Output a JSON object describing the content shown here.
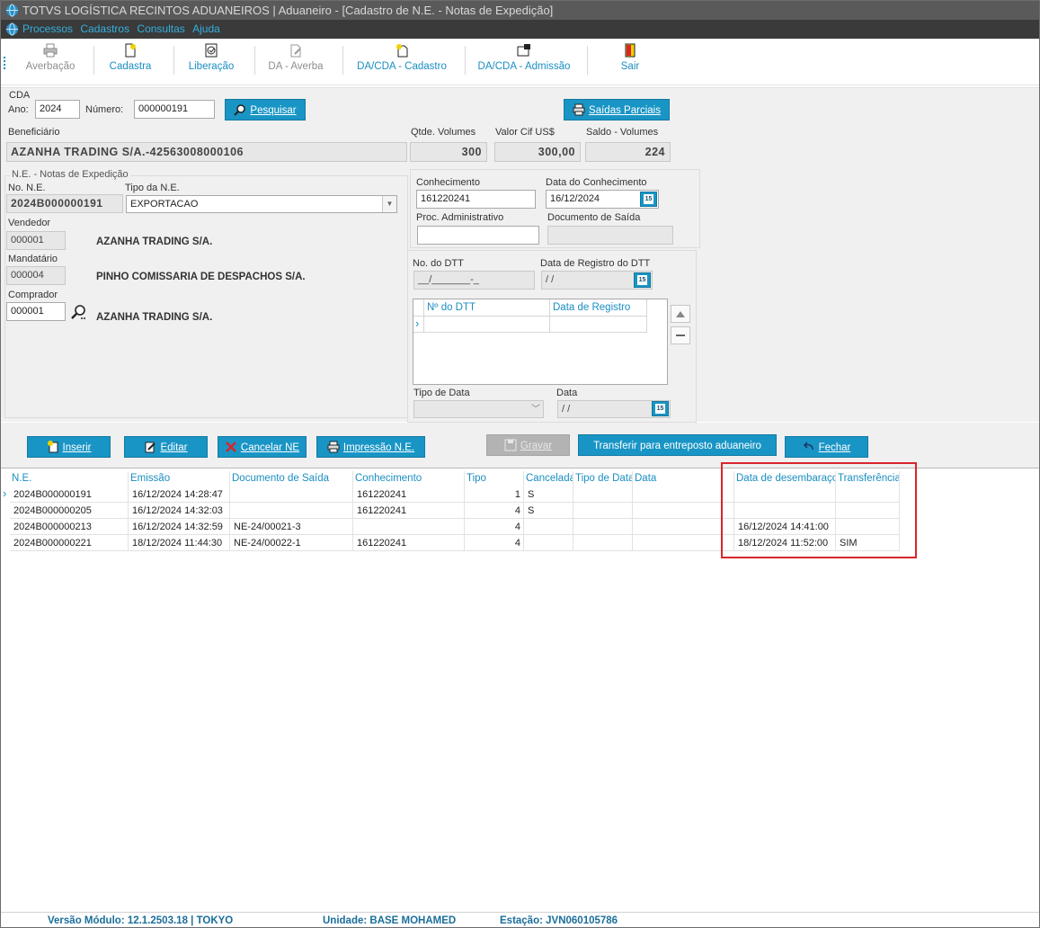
{
  "title": "TOTVS LOGÍSTICA RECINTOS ADUANEIROS | Aduaneiro - [Cadastro de N.E. - Notas de Expedição]",
  "menu": [
    "Processos",
    "Cadastros",
    "Consultas",
    "Ajuda"
  ],
  "toolbar": {
    "averbacao": "Averbação",
    "cadastra": "Cadastra",
    "liberacao": "Liberação",
    "da_averba": "DA - Averba",
    "dacda_cadastro": "DA/CDA - Cadastro",
    "dacda_admissao": "DA/CDA - Admissão",
    "sair": "Sair"
  },
  "cda": {
    "section": "CDA",
    "ano_label": "Ano:",
    "ano": "2024",
    "numero_label": "Número:",
    "numero": "000000191",
    "pesquisar": "Pesquisar",
    "saidas_parciais": "Saídas Parciais"
  },
  "beneficiario": {
    "label": "Beneficiário",
    "value": "AZANHA TRADING S/A.-42563008000106",
    "qtde_label": "Qtde. Volumes",
    "qtde": "300",
    "valor_label": "Valor Cif US$",
    "valor": "300,00",
    "saldo_label": "Saldo - Volumes",
    "saldo": "224"
  },
  "ne": {
    "group": "N.E. - Notas de Expedição",
    "no_label": "No. N.E.",
    "no": "2024B000000191",
    "tipo_label": "Tipo da N.E.",
    "tipo": "EXPORTACAO",
    "vendedor_label": "Vendedor",
    "vendedor_code": "000001",
    "vendedor_name": "AZANHA TRADING S/A.",
    "mandatario_label": "Mandatário",
    "mandatario_code": "000004",
    "mandatario_name": "PINHO COMISSARIA DE DESPACHOS S/A.",
    "comprador_label": "Comprador",
    "comprador_code": "000001",
    "comprador_name": "AZANHA TRADING S/A."
  },
  "conhecimento": {
    "label": "Conhecimento",
    "value": "161220241",
    "data_label": "Data do Conhecimento",
    "data": "16/12/2024",
    "proc_label": "Proc. Administrativo",
    "proc": "",
    "doc_label": "Documento de Saída",
    "doc": ""
  },
  "dtt": {
    "no_label": "No. do DTT",
    "no_mask": "__/_______-_",
    "data_reg_label": "Data de Registro do DTT",
    "data_reg": " /  /",
    "grid_col1": "Nº do DTT",
    "grid_col2": "Data de Registro",
    "tipo_data_label": "Tipo de Data",
    "data_label": "Data",
    "data": " /  /"
  },
  "actions": {
    "inserir": "Inserir",
    "editar": "Editar",
    "cancelar": "Cancelar NE",
    "impressao": "Impressão N.E.",
    "gravar": "Gravar",
    "transferir": "Transferir para entreposto aduaneiro",
    "fechar": "Fechar"
  },
  "grid": {
    "columns": [
      "N.E.",
      "Emissão",
      "Documento de Saída",
      "Conhecimento",
      "Tipo",
      "Cancelada",
      "Tipo de Data",
      "Data",
      "Data de desembaraço",
      "Transferência"
    ],
    "rows": [
      [
        "2024B000000191",
        "16/12/2024 14:28:47",
        "",
        "161220241",
        "1",
        "S",
        "",
        "",
        "",
        ""
      ],
      [
        "2024B000000205",
        "16/12/2024 14:32:03",
        "",
        "161220241",
        "4",
        "S",
        "",
        "",
        "",
        ""
      ],
      [
        "2024B000000213",
        "16/12/2024 14:32:59",
        "NE-24/00021-3",
        "",
        "4",
        "",
        "",
        "",
        "16/12/2024 14:41:00",
        ""
      ],
      [
        "2024B000000221",
        "18/12/2024 11:44:30",
        "NE-24/00022-1",
        "161220241",
        "4",
        "",
        "",
        "",
        "18/12/2024 11:52:00",
        "SIM"
      ]
    ]
  },
  "status": {
    "versao": "Versão Módulo:  12.1.2503.18  |  TOKYO",
    "unidade": "Unidade:  BASE MOHAMED",
    "estacao": "Estação:  JVN060105786"
  },
  "colors": {
    "accent": "#1995c5",
    "highlight": "#d8262c",
    "titlebar": "#5a5a5a",
    "menubar": "#3a3a3a"
  }
}
